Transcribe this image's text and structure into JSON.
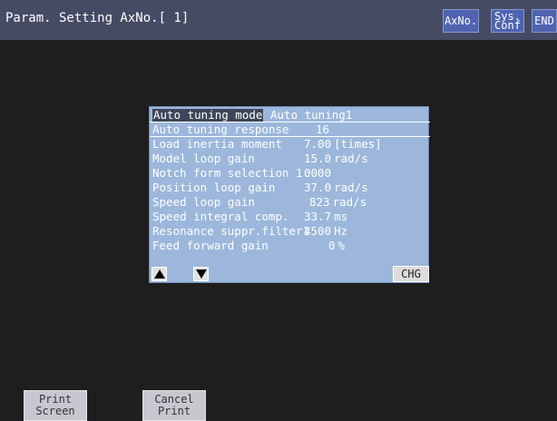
{
  "header": {
    "title": "Param. Setting AxNo.[ 1]",
    "axno_label": "AxNo.",
    "sys_conf_line1": "Sys.",
    "sys_conf_line2": "Conf",
    "end_label": "END"
  },
  "panel": {
    "mode_label": "Auto tuning mode",
    "mode_value": "Auto tuning1",
    "rows": [
      {
        "label": "Auto tuning response",
        "value": "16",
        "unit": ""
      },
      {
        "label": "Load inertia moment",
        "value": "7.00",
        "unit": "[times]"
      },
      {
        "label": "Model loop gain",
        "value": "15.0",
        "unit": "rad/s"
      },
      {
        "label": "Notch form selection 1",
        "value": "0000",
        "unit": ""
      },
      {
        "label": "Position loop gain",
        "value": "37.0",
        "unit": "rad/s"
      },
      {
        "label": "Speed loop gain",
        "value": "823",
        "unit": "rad/s"
      },
      {
        "label": "Speed integral comp.",
        "value": "33.7",
        "unit": "ms"
      },
      {
        "label": "Resonance suppr.filter1",
        "value": "4500",
        "unit": "Hz"
      },
      {
        "label": "Feed forward gain",
        "value": "0",
        "unit": "%"
      }
    ],
    "chg_label": "CHG"
  },
  "footer": {
    "print_line1": "Print",
    "print_line2": "Screen",
    "cancel_line1": "Cancel",
    "cancel_line2": "Print"
  },
  "colors": {
    "title_bar": "#454b63",
    "button_blue": "#4f63b1",
    "panel_bg": "#9cb7db",
    "background": "#1e1e1e"
  }
}
